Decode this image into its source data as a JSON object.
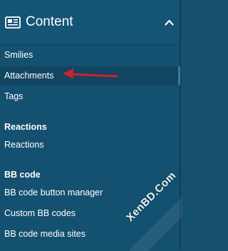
{
  "header": {
    "title": "Content",
    "icon": "newspaper-icon",
    "toggle_icon": "chevron-up-icon"
  },
  "items": [
    {
      "label": "Smilies"
    },
    {
      "label": "Attachments"
    },
    {
      "label": "Tags"
    }
  ],
  "sections": [
    {
      "heading": "Reactions",
      "items": [
        {
          "label": "Reactions"
        }
      ]
    },
    {
      "heading": "BB code",
      "items": [
        {
          "label": "BB code button manager"
        },
        {
          "label": "Custom BB codes"
        },
        {
          "label": "BB code media sites"
        }
      ]
    }
  ],
  "annotation": {
    "icon": "red-arrow-icon",
    "color": "#d8202a"
  },
  "watermark": {
    "text": "XenBD.Com"
  },
  "colors": {
    "background": "#14506f",
    "active_item": "#114562",
    "text": "#ffffff"
  }
}
